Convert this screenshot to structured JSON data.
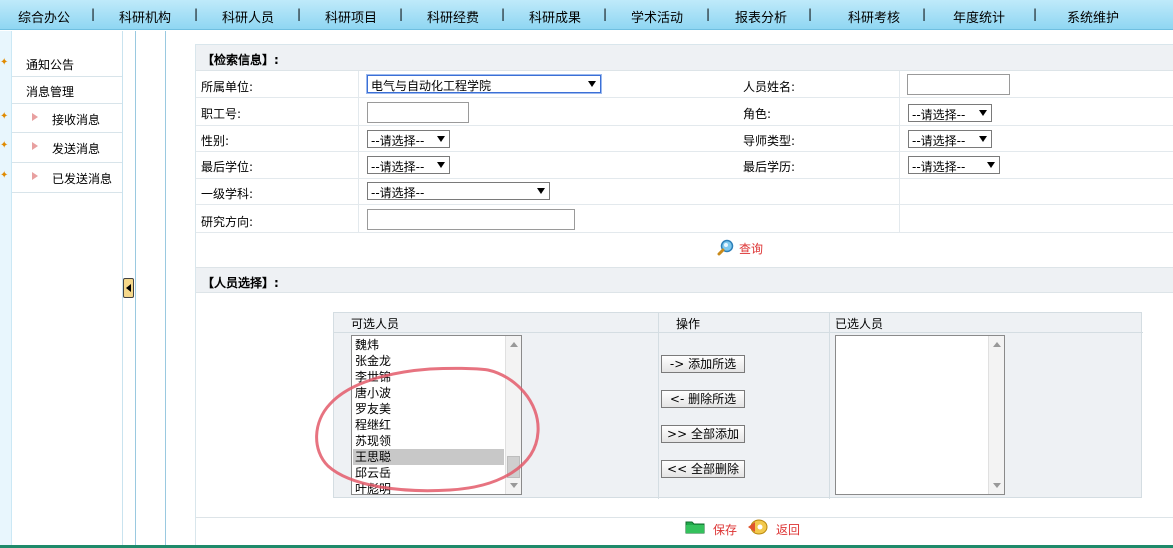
{
  "topnav": {
    "items": [
      "综合办公",
      "科研机构",
      "科研人员",
      "科研项目",
      "科研经费",
      "科研成果",
      "学术活动",
      "报表分析",
      "科研考核",
      "年度统计",
      "系统维护"
    ],
    "separator": "|"
  },
  "sidebar": {
    "items": [
      {
        "label": "通知公告"
      },
      {
        "label": "消息管理"
      },
      {
        "label": "接收消息"
      },
      {
        "label": "发送消息"
      },
      {
        "label": "已发送消息"
      }
    ]
  },
  "search_section": {
    "title": "【检索信息】:",
    "fields": {
      "unit": {
        "label": "所属单位:",
        "value": "电气与自动化工程学院"
      },
      "name": {
        "label": "人员姓名:",
        "value": ""
      },
      "staff_id": {
        "label": "职工号:",
        "value": ""
      },
      "role": {
        "label": "角色:",
        "value": "--请选择--"
      },
      "gender": {
        "label": "性别:",
        "value": "--请选择--"
      },
      "tutor_type": {
        "label": "导师类型:",
        "value": "--请选择--"
      },
      "last_degree": {
        "label": "最后学位:",
        "value": "--请选择--"
      },
      "last_education": {
        "label": "最后学历:",
        "value": "--请选择--"
      },
      "discipline": {
        "label": "一级学科:",
        "value": "--请选择--"
      },
      "research_direction": {
        "label": "研究方向:",
        "value": ""
      }
    },
    "search_label": "查询"
  },
  "person_section": {
    "title": "【人员选择】:",
    "available_header": "可选人员",
    "ops_header": "操作",
    "selected_header": "已选人员",
    "available": [
      "魏炜",
      "张金龙",
      "李世锦",
      "唐小波",
      "罗友美",
      "程继红",
      "苏现领",
      "王思聪",
      "邱云岳",
      "叶彪明"
    ],
    "highlighted": "王思聪",
    "selected": [],
    "buttons": {
      "add_selected": "-> 添加所选",
      "remove_selected": "<- 删除所选",
      "add_all": ">> 全部添加",
      "remove_all": "<< 全部删除"
    }
  },
  "footer": {
    "save_label": "保存",
    "back_label": "返回"
  },
  "colors": {
    "nav_bg": "#9fdcf4",
    "accent_red": "#dd3333",
    "annotation": "#e35a6a",
    "section_bg": "#eef1f4"
  }
}
